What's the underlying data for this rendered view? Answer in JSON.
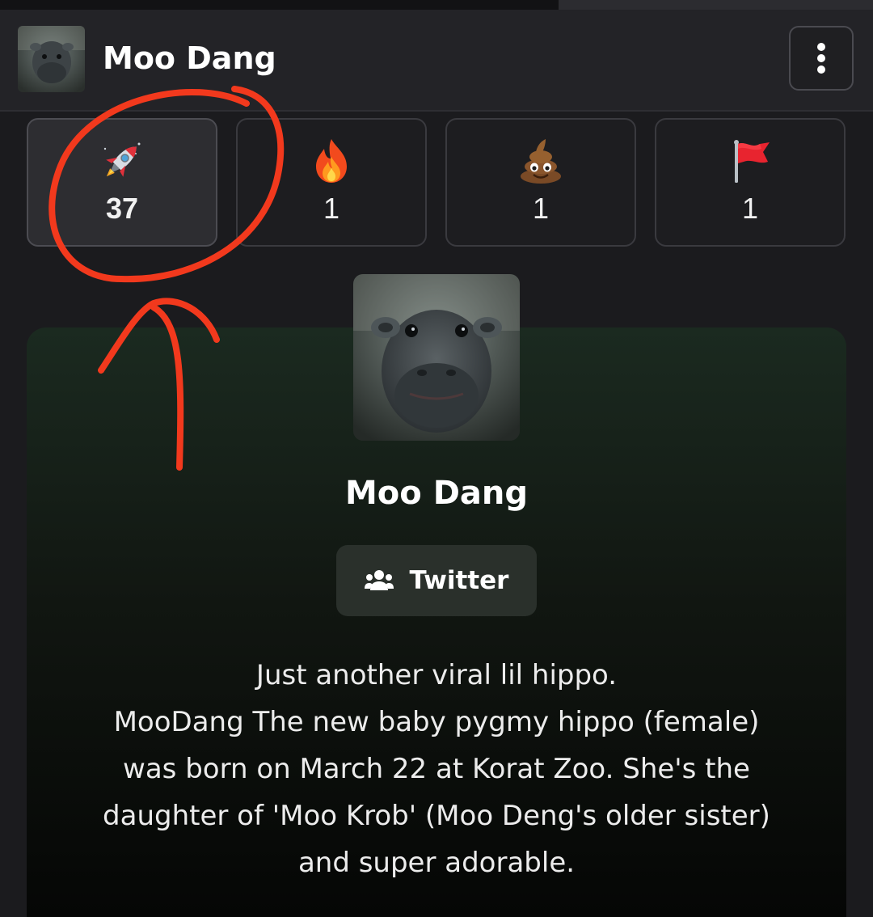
{
  "page": {
    "progress": 0.64
  },
  "header": {
    "title": "Moo Dang",
    "avatar_alt": "hippo"
  },
  "reactions": [
    {
      "icon": "rocket-icon",
      "count": "37",
      "active": true
    },
    {
      "icon": "fire-icon",
      "count": "1",
      "active": false
    },
    {
      "icon": "poop-icon",
      "count": "1",
      "active": false
    },
    {
      "icon": "red-flag-icon",
      "count": "1",
      "active": false
    }
  ],
  "profile": {
    "name": "Moo Dang",
    "social_button": {
      "label": "Twitter",
      "icon": "users-icon"
    },
    "description_lines": [
      "Just another viral lil hippo.",
      "MooDang The new baby pygmy hippo (female)",
      "was born on March 22 at Korat Zoo. She's the",
      "daughter of 'Moo Krob' (Moo Deng's older sister)",
      "and super adorable."
    ]
  },
  "colors": {
    "background": "#1b1b1e",
    "header": "#232327",
    "card_top": "#1b2a20",
    "annotation": "#f2391d",
    "button": "#2a302b"
  }
}
